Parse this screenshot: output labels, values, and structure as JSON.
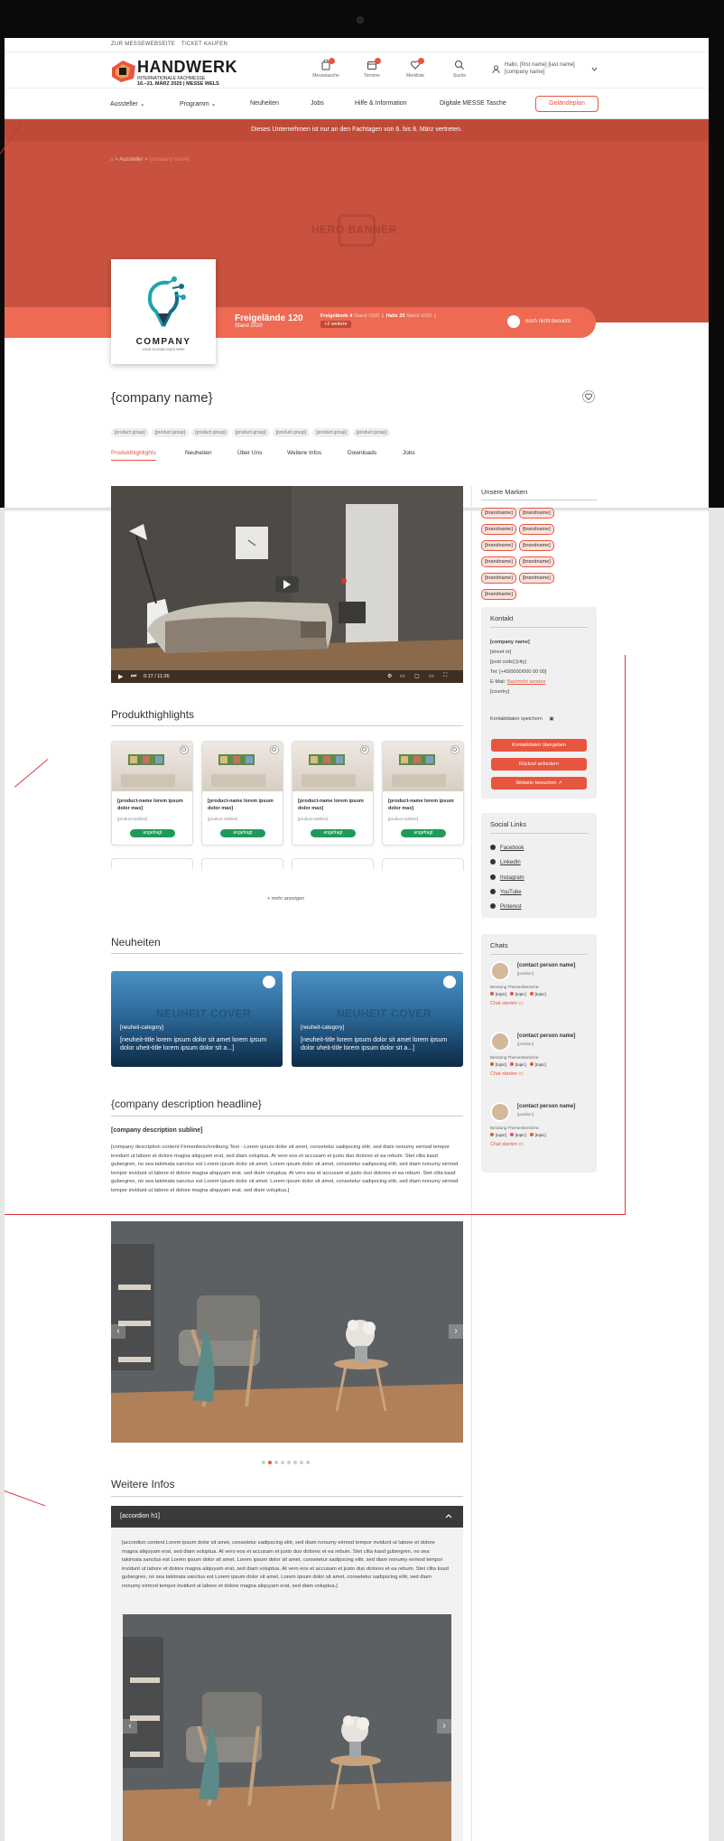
{
  "util": {
    "link1": "ZUR MESSEWEBSEITE",
    "link2": "TICKET KAUFEN"
  },
  "logo": {
    "title": "HANDWERK",
    "sub": "INTERNATIONALE FACHMESSE",
    "date": "16.–21. MÄRZ 2025 | MESSE WELS"
  },
  "header_icons": [
    {
      "icon": "bag-icon",
      "label": "Messetasche"
    },
    {
      "icon": "calendar-icon",
      "label": "Termine"
    },
    {
      "icon": "heart-icon",
      "label": "Merkliste"
    },
    {
      "icon": "search-icon",
      "label": "Suche"
    }
  ],
  "user": {
    "line1": "Hallo, [first name] [last name]",
    "line2": "[company name]"
  },
  "nav": {
    "items": [
      "Aussteller",
      "Programm",
      "Neuheiten",
      "Jobs",
      "Hilfe & Information",
      "Digitale MESSE Tasche"
    ],
    "plan_button": "Geländeplan"
  },
  "notice": "Dieses Unternehmen ist nur an den Fachtagen von 6. bis 8. März vertreten.",
  "breadcrumb": [
    "Aussteller",
    "[company name]"
  ],
  "hero": {
    "banner_text": "HERO BANNER"
  },
  "stand": {
    "title": "Freigelände 120",
    "sub": "Stand 2020",
    "chip1": "Freigelände 4",
    "chip1b": "Stand 1020",
    "chip2": "Halle 20",
    "chip2b": "Stand 1020",
    "chip3": "+2 weitere",
    "visited": "noch nicht besucht"
  },
  "company_logo": {
    "name": "COMPANY",
    "tagline": "YOUR SLOGAN GOES HERE"
  },
  "company": {
    "name": "{company name}",
    "groups": [
      "[product group]",
      "[product group]",
      "[product group]",
      "[product group]",
      "[product group]",
      "[product group]",
      "[product group]"
    ]
  },
  "tabs": [
    "Produkthighlights",
    "Neuheiten",
    "Über Uns",
    "Weitere Infos",
    "Downloads",
    "Jobs"
  ],
  "video": {
    "time": "0:17 / 11:26"
  },
  "brands": {
    "title": "Unsere Marken",
    "items": [
      "[brandname]",
      "[brandname]",
      "[brandname]",
      "[brandname]",
      "[brandname]",
      "[brandname]",
      "[brandname]",
      "[brandname]",
      "[brandname]",
      "[brandname]",
      "[brandname]"
    ]
  },
  "contact": {
    "title": "Kontakt",
    "company": "[company name]",
    "street": "[street nr]",
    "city": "[post code] [city]",
    "tel": "Tel: [+43/0000/000 00 00]",
    "email_label": "E-Mail:",
    "email_link": "Nachricht senden",
    "country": "[country]",
    "save_label": "Kontaktdaten speichern",
    "btn1": "Kontaktdaten übergeben",
    "btn2": "Rückruf anfordern",
    "btn3": "Website besuchen"
  },
  "social": {
    "title": "Social Links",
    "items": [
      "Facebook",
      "LinkedIn",
      "Instagram",
      "YouTube",
      "Pinterest"
    ]
  },
  "chats": {
    "title": "Chats",
    "items": [
      {
        "name": "[contact person name]",
        "position": "[position]",
        "area": "Beratung Themenbereiche:",
        "topics": [
          "[topic]",
          "[topic]",
          "[topic]"
        ],
        "start": "Chat starten"
      },
      {
        "name": "[contact person name]",
        "position": "[position]",
        "area": "Beratung Themenbereiche:",
        "topics": [
          "[topic]",
          "[topic]",
          "[topic]"
        ],
        "start": "Chat starten"
      },
      {
        "name": "[contact person name]",
        "position": "[position]",
        "area": "Beratung Themenbereiche:",
        "topics": [
          "[topic]",
          "[topic]",
          "[topic]"
        ],
        "start": "Chat starten"
      }
    ]
  },
  "highlights": {
    "title": "Produkthighlights",
    "products": [
      {
        "name": "[product-name lorem ipsum dolor max]",
        "sub": "[product-subline]",
        "status": "angefragt"
      },
      {
        "name": "[product-name lorem ipsum dolor max]",
        "sub": "[product-subline]",
        "status": "angefragt"
      },
      {
        "name": "[product-name lorem ipsum dolor max]",
        "sub": "[product-subline]",
        "status": "angefragt"
      },
      {
        "name": "[product-name lorem ipsum dolor max]",
        "sub": "[product-subline]",
        "status": "angefragt"
      }
    ],
    "more": "mehr anzeigen"
  },
  "news": {
    "title": "Neuheiten",
    "items": [
      {
        "cover": "NEUHEIT COVER",
        "category": "[neuheit-category]",
        "title": "[neuheit-title lorem ipsum dolor sit amet lorem ipsum dolor uheit-title lorem ipsum dolor sit a...]"
      },
      {
        "cover": "NEUHEIT COVER",
        "category": "[neuheit-category]",
        "title": "[neuheit-title lorem ipsum dolor sit amet lorem ipsum dolor uheit-title lorem ipsum dolor sit a...]"
      }
    ]
  },
  "description": {
    "headline": "{company description headline}",
    "subline": "[company description subline]",
    "text": "[company description content Firmenbeschreibung Text - Lorem ipsum dolor sit amet, consetetur sadipscing elitr, sed diam nonumy eirmod tempor invidunt ut labore et dolore magna aliquyam erat, sed diam voluptua. At vero eos et accusam et justo duo dolores et ea rebum. Stet clita kasd gubergren, no sea takimata sanctus est Lorem ipsum dolor sit amet. Lorem ipsum dolor sit amet, consetetur sadipscing elitr, sed diam nonumy eirmod tempor invidunt ut labore et dolore magna aliquyam erat, sed diam voluptua. At vero eos et accusam et justo duo dolores et ea rebum. Stet clita kasd gubergren, no sea takimata sanctus est Lorem ipsum dolor sit amet. Lorem ipsum dolor sit amet, consetetur sadipscing elitr, sed diam nonumy eirmod tempor invidunt ut labore et dolore magna aliquyam erat, sed diam voluptua.]"
  },
  "weitere": {
    "title": "Weitere Infos",
    "accordion_title": "[accordion h1]",
    "accordion_text": "[accordion content Lorem ipsum dolor sit amet, consetetur sadipscing elitr, sed diam nonumy eirmod tempor invidunt ut labore et dolore magna aliquyam erat, sed diam voluptua. At vero eos et accusam et justo duo dolores et ea rebum. Stet clita kasd gubergren, no sea takimata sanctus est Lorem ipsum dolor sit amet. Lorem ipsum dolor sit amet, consetetur sadipscing elitr, sed diam nonumy eirmod tempor invidunt ut labore et dolore magna aliquyam erat, sed diam voluptua. At vero eos et accusam et justo duo dolores et ea rebum. Stet clita kasd gubergren, no sea takimata sanctus est Lorem ipsum dolor sit amet. Lorem ipsum dolor sit amet, consetetur sadipscing elitr, sed diam nonumy eirmod tempor invidunt ut labore et dolore magna aliquyam erat, sed diam voluptua.]"
  },
  "colors": {
    "accent": "#e8553f",
    "hero": "#c8523f",
    "success": "#1f9a5b"
  }
}
